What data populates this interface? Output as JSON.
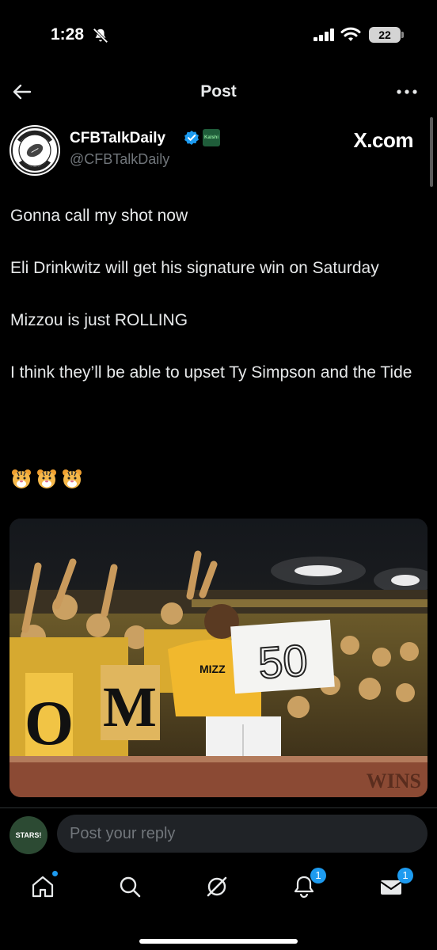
{
  "status_bar": {
    "time": "1:28",
    "battery": "22",
    "icons": [
      "bell-off-icon",
      "signal-icon",
      "wifi-icon",
      "battery-icon"
    ]
  },
  "header": {
    "title": "Post",
    "back_icon": "arrow-left-icon",
    "more_icon": "more-dots-icon"
  },
  "author": {
    "display_name": "CFBTalkDaily",
    "handle": "@CFBTalkDaily",
    "avatar_text": "CFBTALKDAILY",
    "avatar_est": "EST 2017",
    "affiliate_badge": "Kalshi",
    "source_label": "X.com",
    "verified_icon": "verified-check-icon"
  },
  "post": {
    "paragraphs": [
      "Gonna call my shot now",
      "Eli Drinkwitz will get his signature win on Saturday",
      "Mizzou is just ROLLING",
      "I think they’ll be able to upset Ty Simpson and the Tide"
    ],
    "emoji": [
      "tiger-face",
      "tiger-face",
      "tiger-face"
    ],
    "photo": {
      "sign_text": "50",
      "jersey_text": "MIZZ",
      "letters": [
        "O",
        "M"
      ],
      "banner_text": "WINS"
    }
  },
  "reply": {
    "avatar_label": "STARS!",
    "placeholder": "Post your reply"
  },
  "nav": {
    "items": [
      {
        "name": "home",
        "icon": "home-icon",
        "dot": true
      },
      {
        "name": "search",
        "icon": "search-icon"
      },
      {
        "name": "grok",
        "icon": "grok-icon"
      },
      {
        "name": "notifications",
        "icon": "bell-icon",
        "count": "1"
      },
      {
        "name": "messages",
        "icon": "mail-icon",
        "count": "1"
      }
    ]
  },
  "colors": {
    "background": "#000000",
    "accent": "#1d9bf0",
    "text": "#e7e9ea",
    "muted": "#71767b",
    "mizzou_gold": "#f1b82d"
  }
}
